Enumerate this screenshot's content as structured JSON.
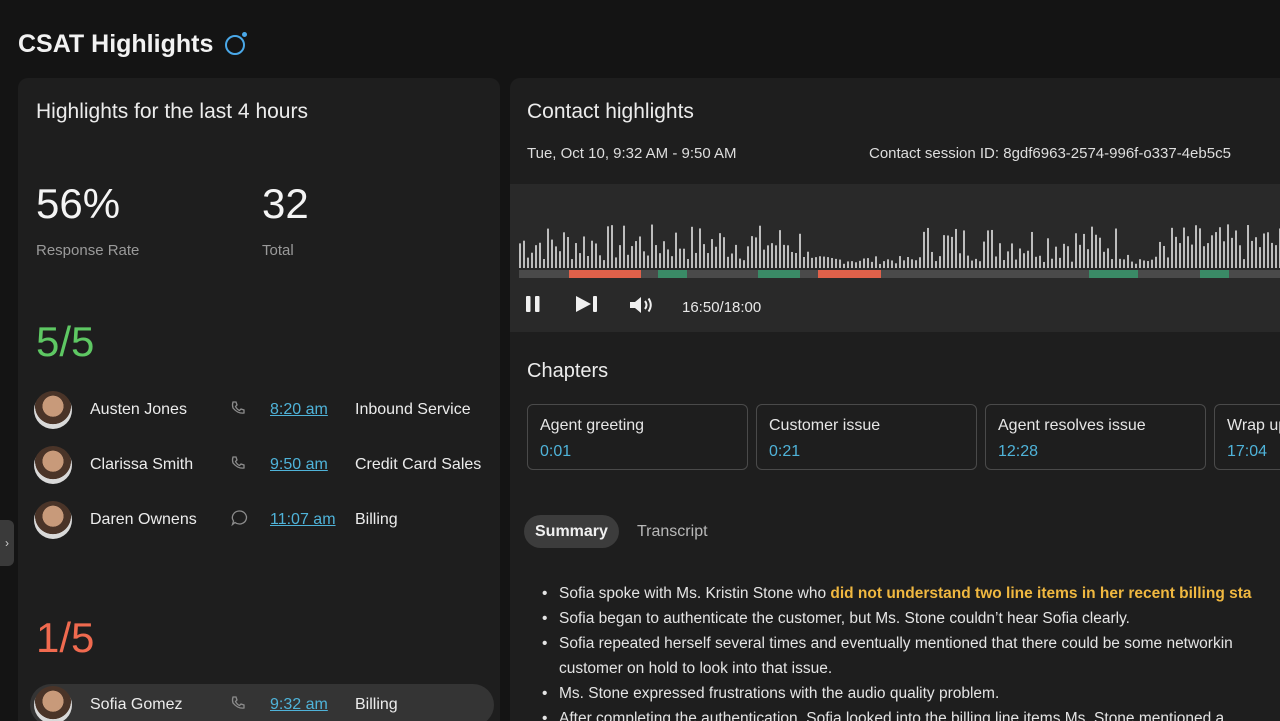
{
  "header": {
    "title": "CSAT Highlights",
    "icon": "refresh-icon"
  },
  "highlights": {
    "heading": "Highlights for the last 4 hours",
    "stats": [
      {
        "value": "56%",
        "label": "Response Rate"
      },
      {
        "value": "32",
        "label": "Total"
      }
    ],
    "good_score": "5/5",
    "bad_score": "1/5",
    "good_contacts": [
      {
        "name": "Austen Jones",
        "channel": "phone-icon",
        "time": "8:20 am",
        "queue": "Inbound Service"
      },
      {
        "name": "Clarissa Smith",
        "channel": "phone-icon",
        "time": "9:50 am",
        "queue": "Credit Card Sales"
      },
      {
        "name": "Daren Ownens",
        "channel": "chat-icon",
        "time": "11:07 am",
        "queue": "Billing"
      }
    ],
    "bad_contacts": [
      {
        "name": "Sofia Gomez",
        "channel": "phone-icon",
        "time": "9:32 am",
        "queue": "Billing"
      }
    ]
  },
  "contact": {
    "heading": "Contact highlights",
    "date_range": "Tue, Oct 10, 9:32 AM - 9:50 AM",
    "session": "Contact session ID: 8gdf6963-2574-996f-o337-4eb5c5",
    "player": {
      "time": "16:50/18:00",
      "progress": 0.935
    },
    "chapters_heading": "Chapters",
    "chapters": [
      {
        "title": "Agent greeting",
        "time": "0:01"
      },
      {
        "title": "Customer issue",
        "time": "0:21"
      },
      {
        "title": "Agent resolves issue",
        "time": "12:28"
      },
      {
        "title": "Wrap up",
        "time": "17:04"
      }
    ],
    "tabs": {
      "summary": "Summary",
      "transcript": "Transcript"
    },
    "summary": {
      "l1a": "Sofia spoke with Ms. Kristin Stone who ",
      "l1b": "did not understand two line items in her recent billing sta",
      "l2": "Sofia began to authenticate the customer, but Ms. Stone couldn’t hear Sofia clearly.",
      "l3": "Sofia repeated herself several times and eventually mentioned that there could be some networkin",
      "l3b": "customer on hold to look into that issue.",
      "l4": "Ms. Stone expressed frustrations with the audio quality problem.",
      "l5": "After completing the authentication, Sofia looked into the billing line items Ms. Stone mentioned a"
    }
  },
  "colors": {
    "positive": "#5ec863",
    "negative": "#f06a4f",
    "link": "#4fb3d9",
    "highlight": "#f0b840"
  }
}
